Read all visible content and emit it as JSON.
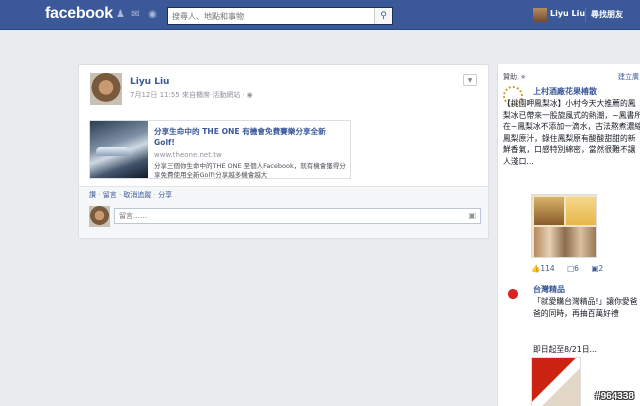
{
  "topbar": {
    "logo": "facebook",
    "search_placeholder": "搜尋人、地點和事物",
    "user_name": "Liyu Liu",
    "find_friends": "尋找朋友"
  },
  "post": {
    "author": "Liyu Liu",
    "meta": "7月12日 11:55 來自櫃席·活動網站 ·",
    "attachment": {
      "title": "分享生命中的 THE ONE 有機會免費賽樂分享全新 Golf!",
      "domain": "www.theone.net.tw",
      "description": "分享三個你生命中的THE ONE 至個人Facebook，就有機會獲得分享免費使用全新Golf!分享越多機會越大"
    },
    "actions": {
      "like": "讚",
      "comment": "留言",
      "unfollow": "取消追蹤",
      "share": "分享",
      "separator": "·"
    },
    "comment_placeholder": "留言……"
  },
  "right": {
    "sponsored": "贊助",
    "create_ad": "建立廣",
    "ad1": {
      "title": "上村酒廠花果椿散",
      "body": "【挑園呷鳳梨冰】小村今天大推薦的鳳梨冰已帶來一股旋風式的熱潮，~鳳書所在~鳳梨冰不添加一滴水，古法熬煮濃縮鳳梨原汁，錄住鳳梨原有酸酸甜甜的新鮮香氣，口感特別綿密，當然很難不讓人淺口...",
      "likes": "114",
      "comments": "6",
      "shares": "2"
    },
    "ad2": {
      "title": "台灣精品",
      "body": "「就愛購台灣精品!」讓你愛爸爸的同時，再抽百萬好禮",
      "date": "即日起至8/21日..."
    }
  },
  "watermark": "#964338"
}
